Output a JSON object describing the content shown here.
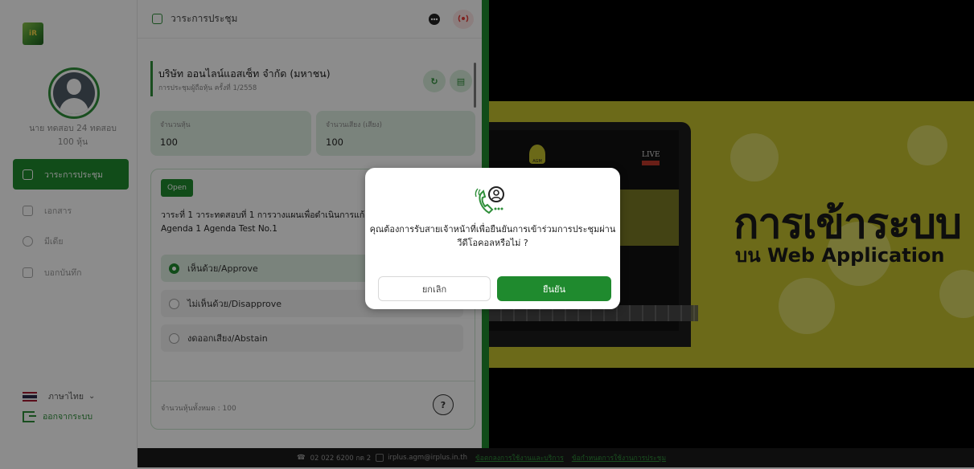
{
  "sidebar": {
    "logo_text": "iR",
    "user_name": "นาย ทดสอบ 24 ทดสอบ",
    "user_shares": "100 หุ้น",
    "items": [
      {
        "label": "วาระการประชุม",
        "icon": "agenda-icon",
        "active": true
      },
      {
        "label": "เอกสาร",
        "icon": "document-icon",
        "active": false
      },
      {
        "label": "มีเดีย",
        "icon": "media-icon",
        "active": false
      },
      {
        "label": "บอกบันทึก",
        "icon": "note-icon",
        "active": false
      }
    ],
    "language": "ภาษาไทย",
    "logout": "ออกจากระบบ"
  },
  "middle": {
    "header_title": "วาระการประชุม",
    "company_name": "บริษัท ออนไลน์แอสเซ็ท จำกัด (มหาชน)",
    "meeting_label": "การประชุมผู้ถือหุ้น ครั้งที่ 1/2558",
    "stats": [
      {
        "label": "จำนวนหุ้น",
        "value": "100"
      },
      {
        "label": "จำนวนเสียง (เสียง)",
        "value": "100"
      }
    ],
    "agenda": {
      "status": "Open",
      "line1": "วาระที่ 1 วาระทดสอบที่ 1 การวางแผนเพื่อดำเนินการแก้",
      "line2": "Agenda 1 Agenda Test No.1",
      "options": [
        {
          "label": "เห็นด้วย/Approve",
          "selected": true
        },
        {
          "label": "ไม่เห็นด้วย/Disapprove",
          "selected": false
        },
        {
          "label": "งดออกเสียง/Abstain",
          "selected": false
        }
      ],
      "total_label": "จำนวนหุ้นทั้งหมด : 100",
      "help": "?"
    }
  },
  "video": {
    "title": "การเข้าระบบ",
    "subtitle": "บน Web Application",
    "live": "LIVE",
    "agm": "AGM"
  },
  "modal": {
    "message_line1": "คุณต้องการรับสายเจ้าหน้าที่เพื่อยืนยันการเข้าร่วมการประชุมผ่าน",
    "message_line2": "วีดีโอคอลหรือไม่ ?",
    "cancel": "ยกเลิก",
    "confirm": "ยืนยัน"
  },
  "footer": {
    "phone": "02 022 6200 กด 2",
    "email": "irplus.agm@irplus.in.th",
    "link1": "ข้อตกลงการใช้งานและบริการ",
    "link2": "ข้อกำหนดการใช้งานการประชุม"
  },
  "colors": {
    "brand_green": "#1f8a2e",
    "light_green": "#dfeee2",
    "banner_yellow": "#c5c22e"
  }
}
